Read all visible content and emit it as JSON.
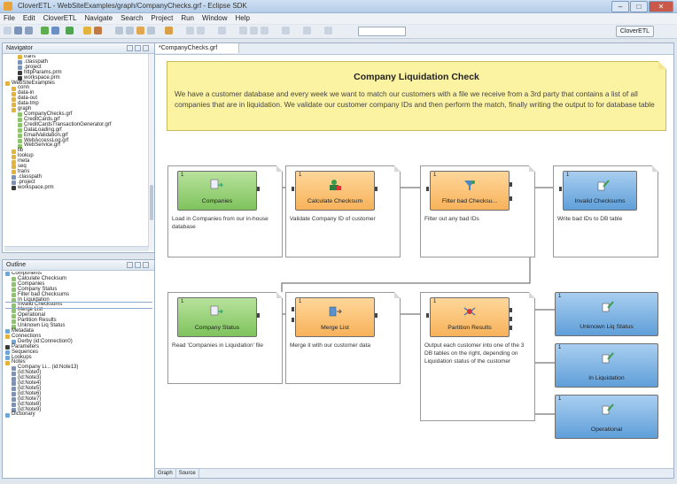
{
  "window": {
    "title": "CloverETL - WebSiteExamples/graph/CompanyChecks.grf - Eclipse SDK"
  },
  "menu": [
    "File",
    "Edit",
    "CloverETL",
    "Navigate",
    "Search",
    "Project",
    "Run",
    "Window",
    "Help"
  ],
  "toolbar": {
    "perspective": "CloverETL"
  },
  "navigator": {
    "tab": "Navigator",
    "items": [
      {
        "label": "trans",
        "icon": "folder-icon",
        "indent": 2
      },
      {
        "label": ".classpath",
        "icon": "file-icon",
        "indent": 2
      },
      {
        "label": ".project",
        "icon": "file-icon",
        "indent": 2
      },
      {
        "label": "httpParams.prm",
        "icon": "params-icon",
        "indent": 2
      },
      {
        "label": "workspace.prm",
        "icon": "params-icon",
        "indent": 2
      },
      {
        "label": "WebSiteExamples",
        "icon": "project-icon",
        "indent": 0
      },
      {
        "label": "conn",
        "icon": "folder-icon",
        "indent": 1
      },
      {
        "label": "data-in",
        "icon": "folder-icon",
        "indent": 1
      },
      {
        "label": "data-out",
        "icon": "folder-icon",
        "indent": 1
      },
      {
        "label": "data-tmp",
        "icon": "folder-icon",
        "indent": 1
      },
      {
        "label": "graph",
        "icon": "folder-icon",
        "indent": 1
      },
      {
        "label": "CompanyChecks.grf",
        "icon": "graph-icon",
        "indent": 2
      },
      {
        "label": "CreditCards.grf",
        "icon": "graph-icon",
        "indent": 2
      },
      {
        "label": "CreditCardsTransactionGenerator.grf",
        "icon": "graph-icon",
        "indent": 2
      },
      {
        "label": "DataLoading.grf",
        "icon": "graph-icon",
        "indent": 2
      },
      {
        "label": "EmailValidation.grf",
        "icon": "graph-icon",
        "indent": 2
      },
      {
        "label": "WebAccessLog.grf",
        "icon": "graph-icon",
        "indent": 2
      },
      {
        "label": "WebService.grf",
        "icon": "graph-icon",
        "indent": 2
      },
      {
        "label": "lib",
        "icon": "folder-icon",
        "indent": 1
      },
      {
        "label": "lookup",
        "icon": "folder-icon",
        "indent": 1
      },
      {
        "label": "meta",
        "icon": "folder-icon",
        "indent": 1
      },
      {
        "label": "seq",
        "icon": "folder-icon",
        "indent": 1
      },
      {
        "label": "trans",
        "icon": "folder-icon",
        "indent": 1
      },
      {
        "label": ".classpath",
        "icon": "file-icon",
        "indent": 1
      },
      {
        "label": ".project",
        "icon": "file-icon",
        "indent": 1
      },
      {
        "label": "workspace.prm",
        "icon": "params-icon",
        "indent": 1
      }
    ]
  },
  "outline": {
    "tab": "Outline",
    "items": [
      {
        "label": "Components",
        "icon": "components-icon",
        "indent": 0
      },
      {
        "label": "Calculate Checksum",
        "icon": "component-icon",
        "indent": 1
      },
      {
        "label": "Companies",
        "icon": "component-icon",
        "indent": 1
      },
      {
        "label": "Company Status",
        "icon": "component-icon",
        "indent": 1
      },
      {
        "label": "Filter bad Checksums",
        "icon": "component-icon",
        "indent": 1
      },
      {
        "label": "In Liquidation",
        "icon": "component-icon",
        "indent": 1
      },
      {
        "label": "Invalid Checksums",
        "icon": "component-icon",
        "indent": 1,
        "selected": true
      },
      {
        "label": "Merge List",
        "icon": "component-icon",
        "indent": 1
      },
      {
        "label": "Operational",
        "icon": "component-icon",
        "indent": 1
      },
      {
        "label": "Partition Results",
        "icon": "component-icon",
        "indent": 1
      },
      {
        "label": "Unknown Liq Status",
        "icon": "component-icon",
        "indent": 1
      },
      {
        "label": "Metadata",
        "icon": "metadata-icon",
        "indent": 0
      },
      {
        "label": "Connections",
        "icon": "connections-icon",
        "indent": 0
      },
      {
        "label": "Derby (id:Connection0)",
        "icon": "db-icon",
        "indent": 1
      },
      {
        "label": "Parameters",
        "icon": "params-icon",
        "indent": 0
      },
      {
        "label": "Sequences",
        "icon": "sequence-icon",
        "indent": 0
      },
      {
        "label": "Lookups",
        "icon": "lookup-icon",
        "indent": 0
      },
      {
        "label": "Notes",
        "icon": "notes-icon",
        "indent": 0
      },
      {
        "label": "Company Li... (id:Note13)",
        "icon": "note-icon",
        "indent": 1
      },
      {
        "label": "(id:Note0)",
        "icon": "note-icon",
        "indent": 1
      },
      {
        "label": "(id:Note3)",
        "icon": "note-icon",
        "indent": 1
      },
      {
        "label": "(id:Note4)",
        "icon": "note-icon",
        "indent": 1
      },
      {
        "label": "(id:Note5)",
        "icon": "note-icon",
        "indent": 1
      },
      {
        "label": "(id:Note6)",
        "icon": "note-icon",
        "indent": 1
      },
      {
        "label": "(id:Note7)",
        "icon": "note-icon",
        "indent": 1
      },
      {
        "label": "(id:Note8)",
        "icon": "note-icon",
        "indent": 1
      },
      {
        "label": "(id:Note9)",
        "icon": "note-icon",
        "indent": 1
      },
      {
        "label": "Dictionary",
        "icon": "dictionary-icon",
        "indent": 0
      }
    ]
  },
  "editor": {
    "tab": "*CompanyChecks.grf",
    "bottom_tabs": [
      "Graph",
      "Source"
    ],
    "note_title": "Company Liquidation Check",
    "note_body": "We have a customer database and every week we want to match our customers with a file we receive from a 3rd party that contains a list of all companies that are in liquidation. We validate our customer company IDs and then perform the match, finally writing the output to for database table"
  },
  "components": {
    "companies": {
      "num": "1",
      "label": "Companies",
      "desc": "Load in Companies from our in-house database",
      "color": "#8cc56a"
    },
    "checksum": {
      "num": "1",
      "label": "Calculate Checksum",
      "desc": "Validate Company ID of customer",
      "color": "#f7b25a"
    },
    "filter": {
      "num": "1",
      "label": "Filter bad Checksu...",
      "desc": "Filter out any bad IDs",
      "color": "#f7b25a"
    },
    "invalid": {
      "num": "1",
      "label": "Invalid Checksums",
      "desc": "Write bad IDs to DB table",
      "color": "#5f9fd9"
    },
    "status": {
      "num": "1",
      "label": "Company Status",
      "desc": "Read 'Companies in Liquidation' file",
      "color": "#8cc56a"
    },
    "merge": {
      "num": "1",
      "label": "Merge List",
      "desc": "Merge it with our customer data",
      "color": "#f7b25a"
    },
    "partition": {
      "num": "1",
      "label": "Partition Results",
      "desc": "Output each customer into one of the 3 DB tables on the right, depending on Liquidation status of the customer",
      "color": "#f7b25a"
    },
    "unknown": {
      "num": "1",
      "label": "Unknown Liq Status",
      "color": "#5f9fd9"
    },
    "inliq": {
      "num": "1",
      "label": "In Liquidation",
      "color": "#5f9fd9"
    },
    "operational": {
      "num": "1",
      "label": "Operational",
      "color": "#5f9fd9"
    }
  }
}
